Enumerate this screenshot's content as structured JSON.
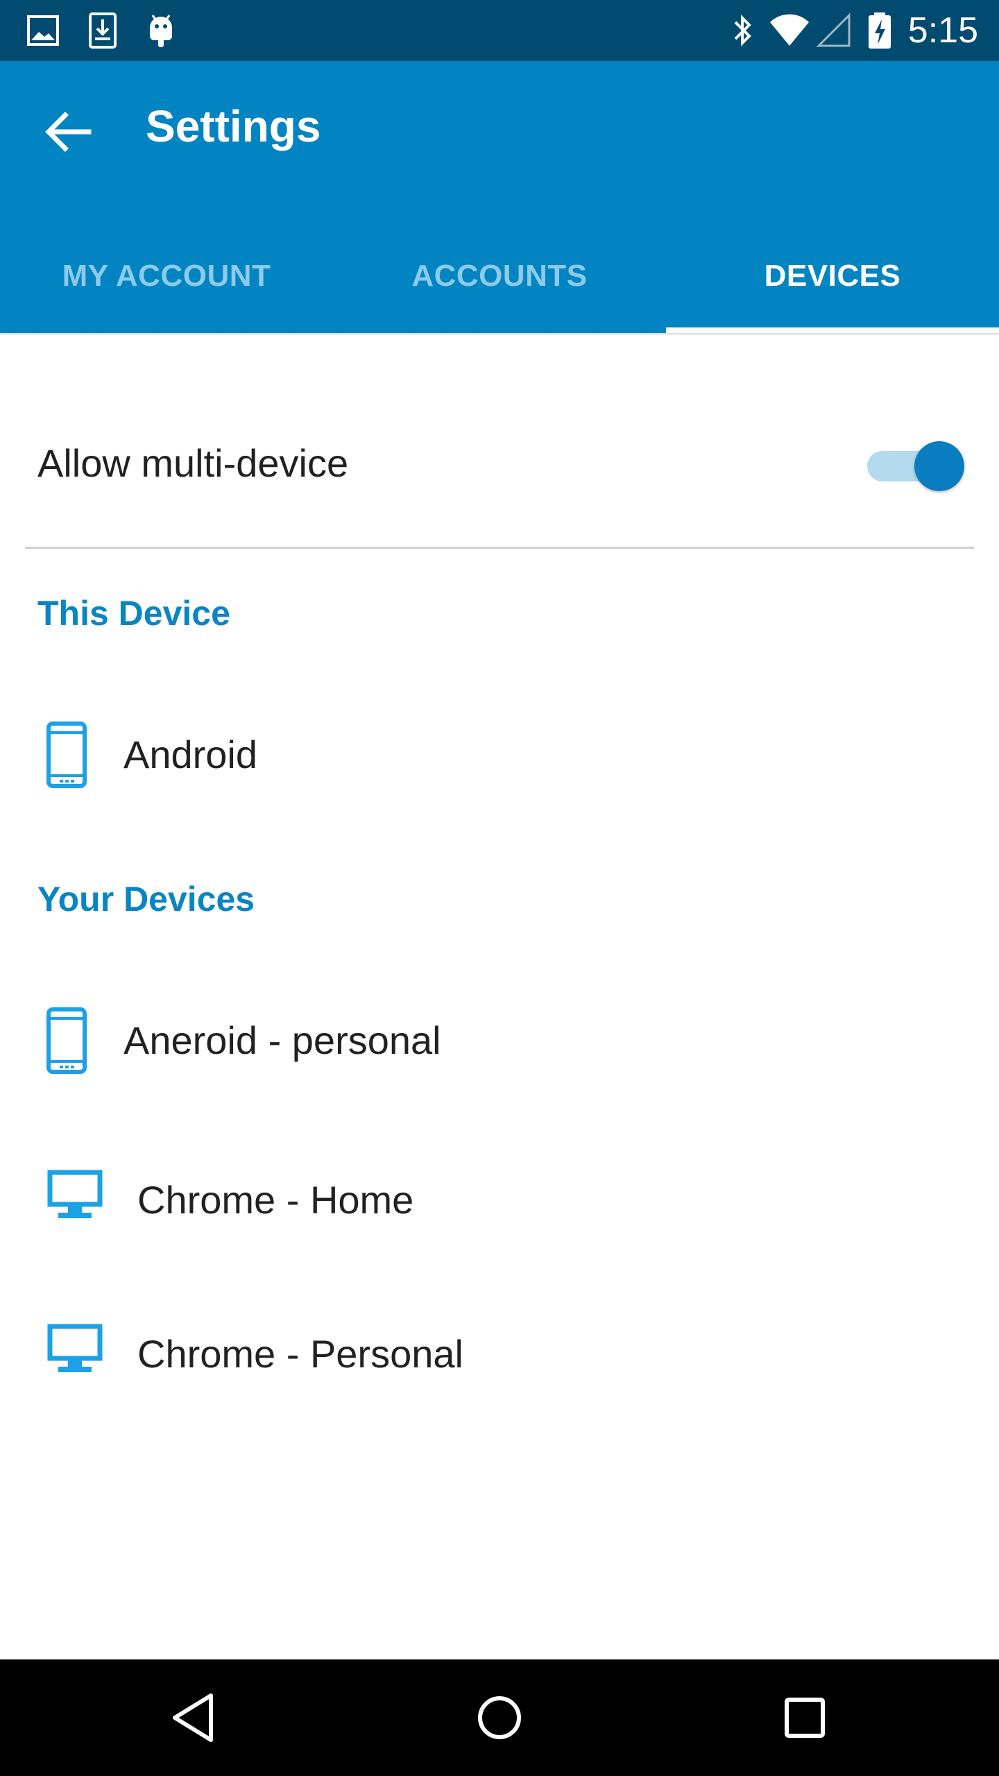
{
  "status_bar": {
    "time": "5:15",
    "left_icons": [
      "image-notification-icon",
      "download-notification-icon",
      "android-notification-icon"
    ],
    "right_icons": [
      "bluetooth-icon",
      "wifi-icon",
      "cell-signal-icon",
      "battery-charging-icon"
    ]
  },
  "app_bar": {
    "title": "Settings",
    "back_icon": "back-arrow-icon",
    "background_color": "#0284c2"
  },
  "tabs": [
    {
      "label": "MY ACCOUNT",
      "active": false
    },
    {
      "label": "ACCOUNTS",
      "active": false
    },
    {
      "label": "DEVICES",
      "active": true
    }
  ],
  "multi_device": {
    "label": "Allow multi-device",
    "enabled": true
  },
  "this_device": {
    "header": "This Device",
    "items": [
      {
        "name": "Android",
        "icon": "phone-icon"
      }
    ]
  },
  "your_devices": {
    "header": "Your Devices",
    "items": [
      {
        "name": "Aneroid - personal",
        "icon": "phone-icon"
      },
      {
        "name": "Chrome - Home",
        "icon": "desktop-icon"
      },
      {
        "name": "Chrome - Personal",
        "icon": "desktop-icon"
      }
    ]
  },
  "nav_bar": {
    "buttons": [
      "back-triangle-icon",
      "home-circle-icon",
      "recents-square-icon"
    ]
  },
  "colors": {
    "accent": "#0a85c4",
    "status_bar": "#024b70",
    "device_icon": "#1da1e6"
  }
}
